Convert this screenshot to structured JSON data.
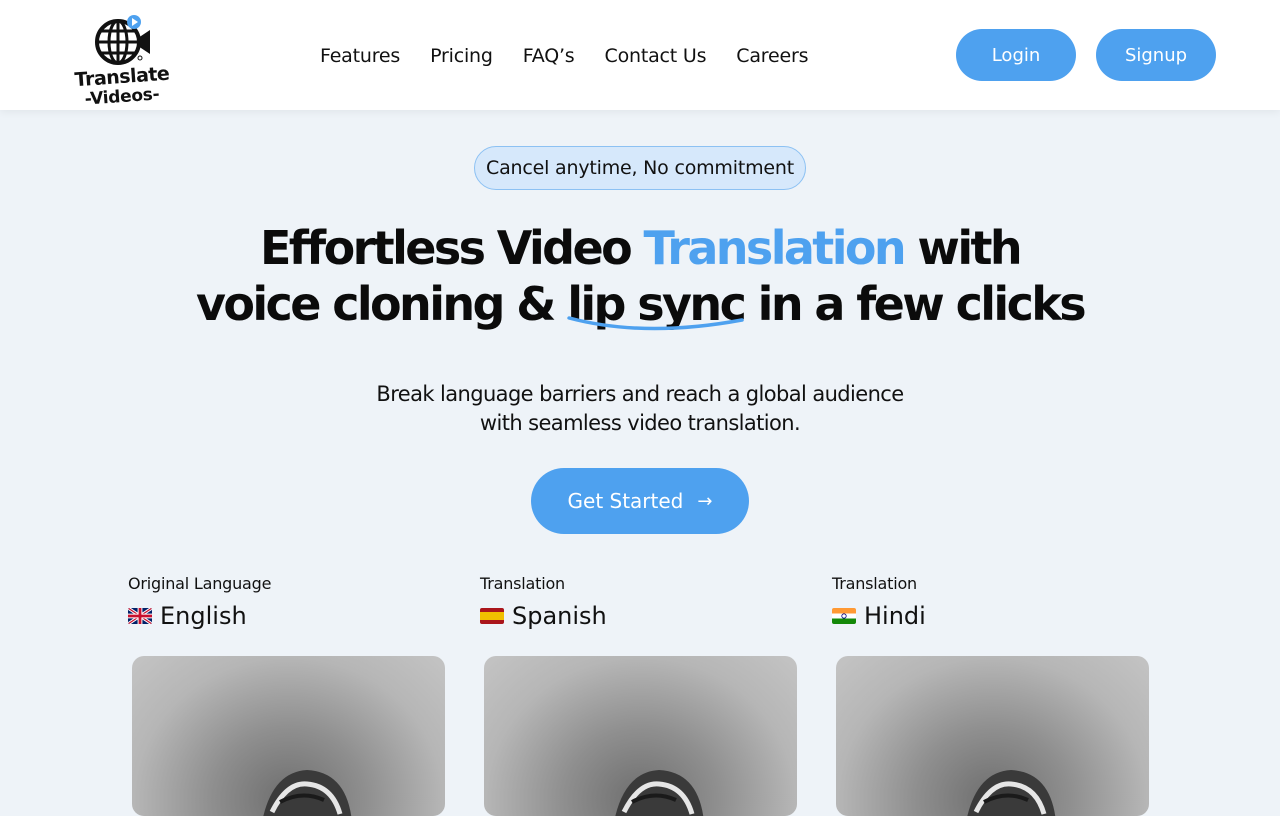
{
  "brand": {
    "logo_line1": "Translate",
    "logo_line2": "-Videos-",
    "accent_color": "#4ea1ef"
  },
  "nav": {
    "items": [
      {
        "label": "Features"
      },
      {
        "label": "Pricing"
      },
      {
        "label": "FAQ’s"
      },
      {
        "label": "Contact Us"
      },
      {
        "label": "Careers"
      }
    ],
    "login_label": "Login",
    "signup_label": "Signup"
  },
  "hero": {
    "badge": "Cancel anytime, No commitment",
    "headline_part1": "Effortless Video ",
    "headline_accent": "Translation",
    "headline_part2": " with",
    "headline_line2_a": "voice cloning & ",
    "headline_lipsync": "lip sync",
    "headline_line2_b": " in a few clicks",
    "subtitle_line1": "Break language barriers and reach a global audience",
    "subtitle_line2": "with seamless video translation.",
    "cta_label": "Get Started",
    "cta_icon": "arrow-right-icon"
  },
  "languages": [
    {
      "caption": "Original Language",
      "name": "English",
      "flag": "uk-flag-icon"
    },
    {
      "caption": "Translation",
      "name": "Spanish",
      "flag": "spain-flag-icon"
    },
    {
      "caption": "Translation",
      "name": "Hindi",
      "flag": "india-flag-icon"
    }
  ]
}
